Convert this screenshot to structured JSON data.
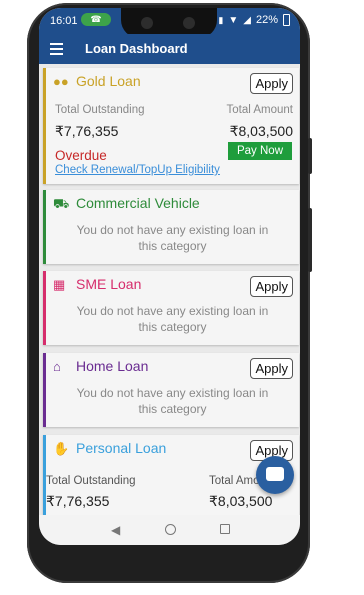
{
  "status": {
    "time": "16:01",
    "call_icon": "phone-icon",
    "battery": "22%"
  },
  "appbar": {
    "title": "Loan Dashboard"
  },
  "cards": {
    "gold": {
      "title": "Gold Loan",
      "apply": "Apply",
      "color": "#c9a227",
      "outstanding_label": "Total Outstanding",
      "outstanding": "₹7,76,355",
      "amount_label": "Total Amount",
      "amount": "₹8,03,500",
      "overdue": "Overdue",
      "paynow": "Pay Now",
      "link": "Check Renewal/TopUp Eligibility"
    },
    "commercial": {
      "title": "Commercial Vehicle",
      "color": "#2e8b3a",
      "empty": "You do not have any existing loan in this category"
    },
    "sme": {
      "title": "SME Loan",
      "apply": "Apply",
      "color": "#d62d6c",
      "empty": "You do not have any existing loan in this category"
    },
    "home": {
      "title": "Home Loan",
      "apply": "Apply",
      "color": "#6a2c91",
      "empty": "You do not have any existing loan in this category"
    },
    "personal": {
      "title": "Personal Loan",
      "apply": "Apply",
      "color": "#3aa0dc",
      "outstanding_label": "Total Outstanding",
      "outstanding": "₹7,76,355",
      "amount_label": "Total Amount",
      "amount": "₹8,03,500"
    }
  }
}
